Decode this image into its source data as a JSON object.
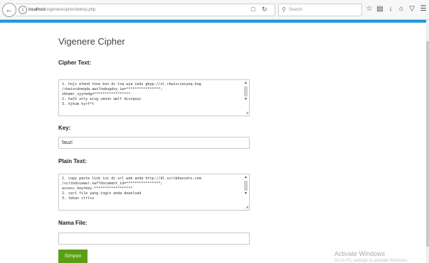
{
  "browser": {
    "url_host": "localhost",
    "url_path": "/vigenerecipher/dekrip.php",
    "search_placeholder": "Search"
  },
  "page": {
    "title": "Vigenere Cipher",
    "cipher_label": "Cipher Text:",
    "cipher_text": "1. hojs efend tnne bvn dc tsq wya iedu gbyp://xl.rkwivciesyea.hog\n/rkwivcdneqda.awz?owbugdvy_iw=****************;\nzkhemr_syy=edg=*****************\n2. halh xnly eisg cmonn umlf divvqouc\n3. kjkum kyrf*t",
    "key_label": "Key:",
    "key_value": "fauzi",
    "plain_label": "Plain Text:",
    "plain_text": "1. copy paste link ini di url web anda http://dl.scribdassets.com\n/scribdviewer.swf?document_id=****************;\naccess_key=key-******************\n2. cari file yang ingin anda download\n3. tekan ctrl+u",
    "filename_label": "Nama File:",
    "filename_value": "",
    "save_label": "Simpan"
  },
  "watermark": {
    "title": "Activate Windows",
    "subtitle": "Go to PC settings to activate Windows."
  },
  "icons": {
    "back": "back-arrow-icon",
    "info": "info-icon",
    "reader": "reader-view-icon",
    "reload": "reload-icon",
    "search": "search-icon",
    "bookmark": "star-icon",
    "library": "clipboard-icon",
    "download": "download-icon",
    "home": "home-icon",
    "pocket": "pocket-icon",
    "menu": "hamburger-menu-icon"
  },
  "colors": {
    "accent": "#1f9ad6",
    "button": "#5a9e16"
  }
}
